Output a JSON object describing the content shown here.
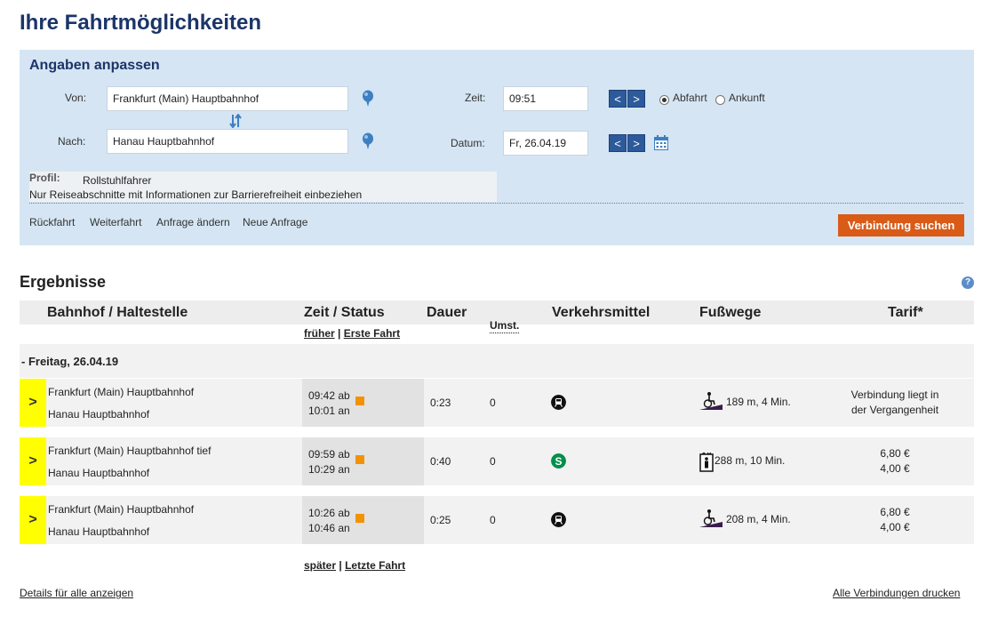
{
  "page": {
    "title": "Ihre Fahrtmöglichkeiten"
  },
  "search": {
    "panel_title": "Angaben anpassen",
    "from_label": "Von:",
    "from_value": "Frankfurt (Main) Hauptbahnhof",
    "to_label": "Nach:",
    "to_value": "Hanau Hauptbahnhof",
    "time_label": "Zeit:",
    "time_value": "09:51",
    "date_label": "Datum:",
    "date_value": "Fr, 26.04.19",
    "prev_symbol": "<",
    "next_symbol": ">",
    "departure_label": "Abfahrt",
    "arrival_label": "Ankunft",
    "selected_mode": "Abfahrt",
    "profile_label": "Profil:",
    "profile_value": "Rollstuhlfahrer",
    "profile_note": "Nur Reiseabschnitte mit Informationen zur Barrierefreiheit einbeziehen",
    "actions": [
      "Rückfahrt",
      "Weiterfahrt",
      "Anfrage ändern",
      "Neue Anfrage"
    ],
    "submit_label": "Verbindung suchen"
  },
  "results": {
    "title": "Ergebnisse",
    "help_symbol": "?",
    "columns": {
      "station": "Bahnhof / Haltestelle",
      "time": "Zeit / Status",
      "duration": "Dauer",
      "changes": "Umst.",
      "transport": "Verkehrsmittel",
      "walks": "Fußwege",
      "fare": "Tarif*"
    },
    "earlier": "früher",
    "first": "Erste Fahrt",
    "later": "später",
    "last": "Letzte Fahrt",
    "separator": "|",
    "day": "- Freitag, 26.04.19",
    "expand_symbol": ">",
    "connections": [
      {
        "from": "Frankfurt (Main) Hauptbahnhof",
        "to": "Hanau Hauptbahnhof",
        "dep": "09:42 ab",
        "arr": "10:01 an",
        "duration": "0:23",
        "changes": "0",
        "transport_icon": "regional-train-icon",
        "walk_icon": "wheelchair-ramp-icon",
        "walk": "189 m, 4 Min.",
        "fare_line1": "Verbindung liegt in",
        "fare_line2": "der Vergangenheit"
      },
      {
        "from": "Frankfurt (Main) Hauptbahnhof tief",
        "to": "Hanau Hauptbahnhof",
        "dep": "09:59 ab",
        "arr": "10:29 an",
        "duration": "0:40",
        "changes": "0",
        "transport_icon": "s-bahn-icon",
        "walk_icon": "elevator-icon",
        "walk": "288 m, 10 Min.",
        "fare_line1": "6,80 €",
        "fare_line2": "4,00 €"
      },
      {
        "from": "Frankfurt (Main) Hauptbahnhof",
        "to": "Hanau Hauptbahnhof",
        "dep": "10:26 ab",
        "arr": "10:46 an",
        "duration": "0:25",
        "changes": "0",
        "transport_icon": "regional-train-icon",
        "walk_icon": "wheelchair-ramp-icon",
        "walk": "208 m, 4 Min.",
        "fare_line1": "6,80 €",
        "fare_line2": "4,00 €"
      }
    ]
  },
  "footer": {
    "details_all": "Details für alle anzeigen",
    "print_all": "Alle Verbindungen drucken"
  },
  "colors": {
    "title": "#1b3569",
    "panel_bg": "#d5e5f3",
    "submit_bg": "#d95b17",
    "expand_bg": "#ffff00",
    "status_square": "#f39200",
    "s_bahn": "#00904a"
  }
}
